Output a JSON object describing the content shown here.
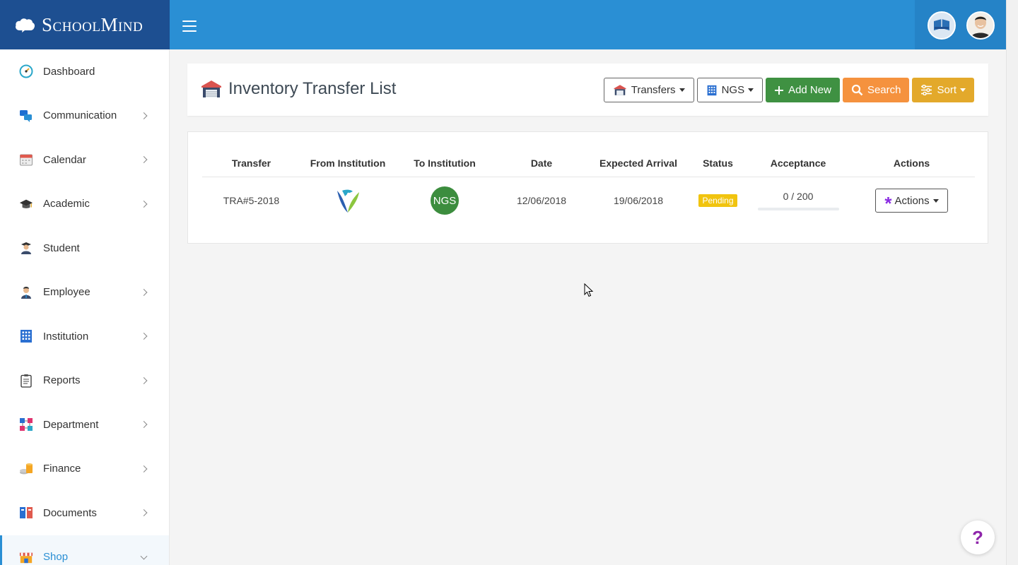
{
  "brand": {
    "name": "SchoolMind"
  },
  "sidebar": {
    "items": [
      {
        "label": "Dashboard",
        "icon": "dashboard-icon",
        "has_children": false
      },
      {
        "label": "Communication",
        "icon": "communication-icon",
        "has_children": true
      },
      {
        "label": "Calendar",
        "icon": "calendar-icon",
        "has_children": true
      },
      {
        "label": "Academic",
        "icon": "graduation-cap-icon",
        "has_children": true
      },
      {
        "label": "Student",
        "icon": "student-icon",
        "has_children": false
      },
      {
        "label": "Employee",
        "icon": "employee-icon",
        "has_children": true
      },
      {
        "label": "Institution",
        "icon": "building-icon",
        "has_children": true
      },
      {
        "label": "Reports",
        "icon": "clipboard-icon",
        "has_children": true
      },
      {
        "label": "Department",
        "icon": "department-icon",
        "has_children": true
      },
      {
        "label": "Finance",
        "icon": "coins-icon",
        "has_children": true
      },
      {
        "label": "Documents",
        "icon": "documents-icon",
        "has_children": true
      },
      {
        "label": "Shop",
        "icon": "shop-icon",
        "has_children": true,
        "active": true
      }
    ]
  },
  "page": {
    "title": "Inventory Transfer List",
    "toolbar": {
      "transfers_label": "Transfers",
      "institution_label": "NGS",
      "add_label": "Add New",
      "search_label": "Search",
      "sort_label": "Sort"
    }
  },
  "table": {
    "headers": [
      "Transfer",
      "From Institution",
      "To Institution",
      "Date",
      "Expected Arrival",
      "Status",
      "Acceptance",
      "Actions"
    ],
    "rows": [
      {
        "transfer": "TRA#5-2018",
        "from_logo": "leaf-logo",
        "to_logo_text": "NGS",
        "date": "12/06/2018",
        "expected_arrival": "19/06/2018",
        "status": "Pending",
        "acceptance": "0 / 200",
        "acceptance_progress": 0,
        "actions_label": "Actions"
      }
    ]
  },
  "help": {
    "label": "?"
  },
  "colors": {
    "header_blue": "#2a8fd4",
    "brand_navy": "#1d4f91",
    "add_green": "#3f9142",
    "search_orange": "#f5923e",
    "sort_gold": "#e3a92b",
    "pending_yellow": "#f1c40f"
  }
}
